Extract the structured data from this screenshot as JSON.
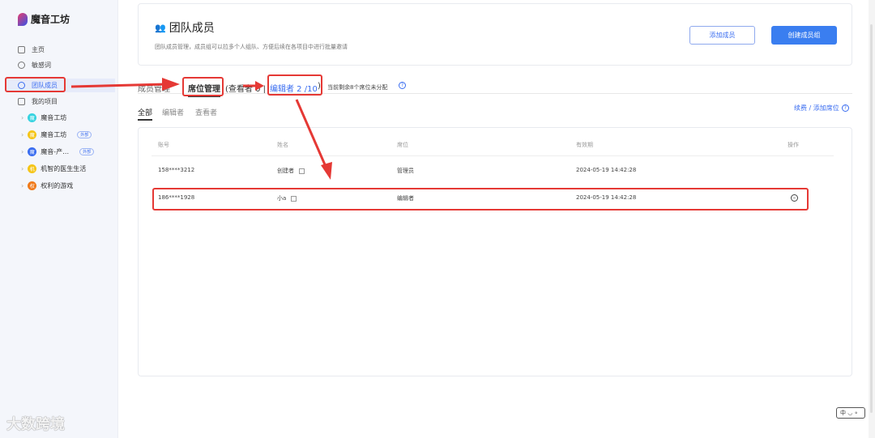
{
  "sidebar": {
    "brand": "魔音工坊",
    "nav": [
      {
        "label": "主页",
        "icon": "home-icon"
      },
      {
        "label": "敏感词",
        "icon": "dollar-icon"
      },
      {
        "label": "团队成员",
        "icon": "team-icon"
      },
      {
        "label": "我的项目",
        "icon": "folder-icon"
      }
    ],
    "projects": [
      {
        "label": "魔音工坊",
        "avatar": "魔",
        "color": "#36d3e0",
        "tag": ""
      },
      {
        "label": "魔音工坊",
        "avatar": "魔",
        "color": "#f5c518",
        "tag": "外部"
      },
      {
        "label": "魔音-产…",
        "avatar": "魔",
        "color": "#3a6df0",
        "tag": "外部"
      },
      {
        "label": "机智的医生生活",
        "avatar": "机",
        "color": "#f5c518",
        "tag": ""
      },
      {
        "label": "权利的游戏",
        "avatar": "权",
        "color": "#f07a1a",
        "tag": ""
      }
    ]
  },
  "header": {
    "title": "团队成员",
    "desc": "团队成员管理，成员组可以拉多个人组队、方便后续在各项目中进行批量邀请",
    "add_member": "添加成员",
    "create_group": "创建成员组"
  },
  "tabs": {
    "members": "成员管理",
    "seats": "席位管理",
    "viewer": "(查看者 0 |",
    "editor": "编辑者 2 /10",
    "close": ")",
    "remaining": "当前剩余8个席位未分配"
  },
  "subtabs": [
    "全部",
    "编辑者",
    "查看者"
  ],
  "renew": "续费 / 添加席位",
  "table": {
    "headers": [
      "账号",
      "姓名",
      "席位",
      "有效期",
      "操作"
    ],
    "rows": [
      {
        "account": "158****3212",
        "name": "创建者",
        "seat": "管理员",
        "expiry": "2024-05-19 14:42:28"
      },
      {
        "account": "186****1928",
        "name": "小a",
        "seat": "编辑者",
        "expiry": "2024-05-19 14:42:28"
      }
    ]
  },
  "ime": "中",
  "watermark": "大数跨境"
}
